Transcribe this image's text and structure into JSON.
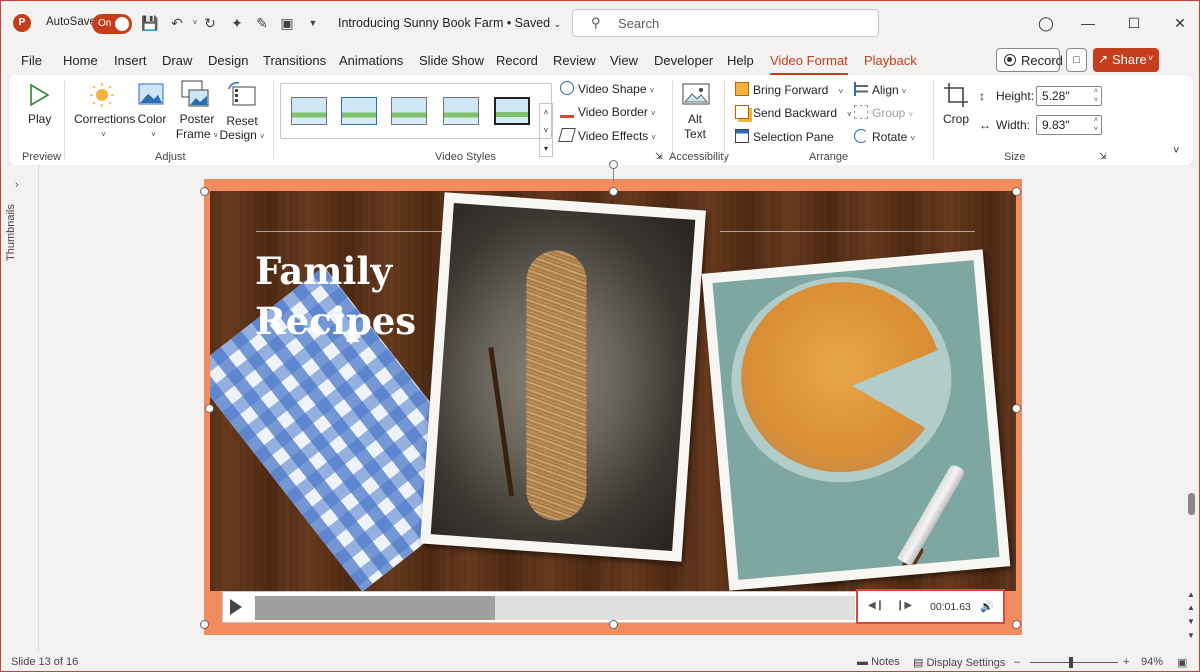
{
  "app": {
    "autosave_label": "AutoSave",
    "autosave_state": "On",
    "doc_title": "Introducing Sunny Book Farm • Saved",
    "search_placeholder": "Search",
    "accent": "#c43e1c"
  },
  "menu": {
    "tabs": [
      "File",
      "Home",
      "Insert",
      "Draw",
      "Design",
      "Transitions",
      "Animations",
      "Slide Show",
      "Record",
      "Review",
      "View",
      "Developer",
      "Help",
      "Video Format",
      "Playback"
    ],
    "active_tab": "Video Format",
    "record_label": "Record",
    "share_label": "Share"
  },
  "ribbon": {
    "preview": {
      "play": "Play",
      "label": "Preview"
    },
    "adjust": {
      "corrections": "Corrections",
      "color": "Color",
      "poster_frame_1": "Poster",
      "poster_frame_2": "Frame",
      "reset_design_1": "Reset",
      "reset_design_2": "Design",
      "label": "Adjust"
    },
    "video_styles": {
      "video_shape": "Video Shape",
      "video_border": "Video Border",
      "video_effects": "Video Effects",
      "label": "Video Styles"
    },
    "accessibility": {
      "alt_text_1": "Alt",
      "alt_text_2": "Text",
      "label": "Accessibility"
    },
    "arrange": {
      "bring_forward": "Bring Forward",
      "send_backward": "Send Backward",
      "selection_pane": "Selection Pane",
      "align": "Align",
      "group": "Group",
      "rotate": "Rotate",
      "label": "Arrange"
    },
    "size": {
      "crop": "Crop",
      "height_label": "Height:",
      "height_value": "5.28\"",
      "width_label": "Width:",
      "width_value": "9.83\"",
      "label": "Size"
    }
  },
  "sidebar": {
    "thumbnails_label": "Thumbnails"
  },
  "slide": {
    "title_line1": "Family",
    "title_line2": "Recipes",
    "video": {
      "progress": 0.4,
      "time": "00:01.63"
    }
  },
  "status": {
    "slide_info": "Slide 13 of 16",
    "notes": "Notes",
    "display_settings": "Display Settings",
    "zoom": "94%"
  }
}
